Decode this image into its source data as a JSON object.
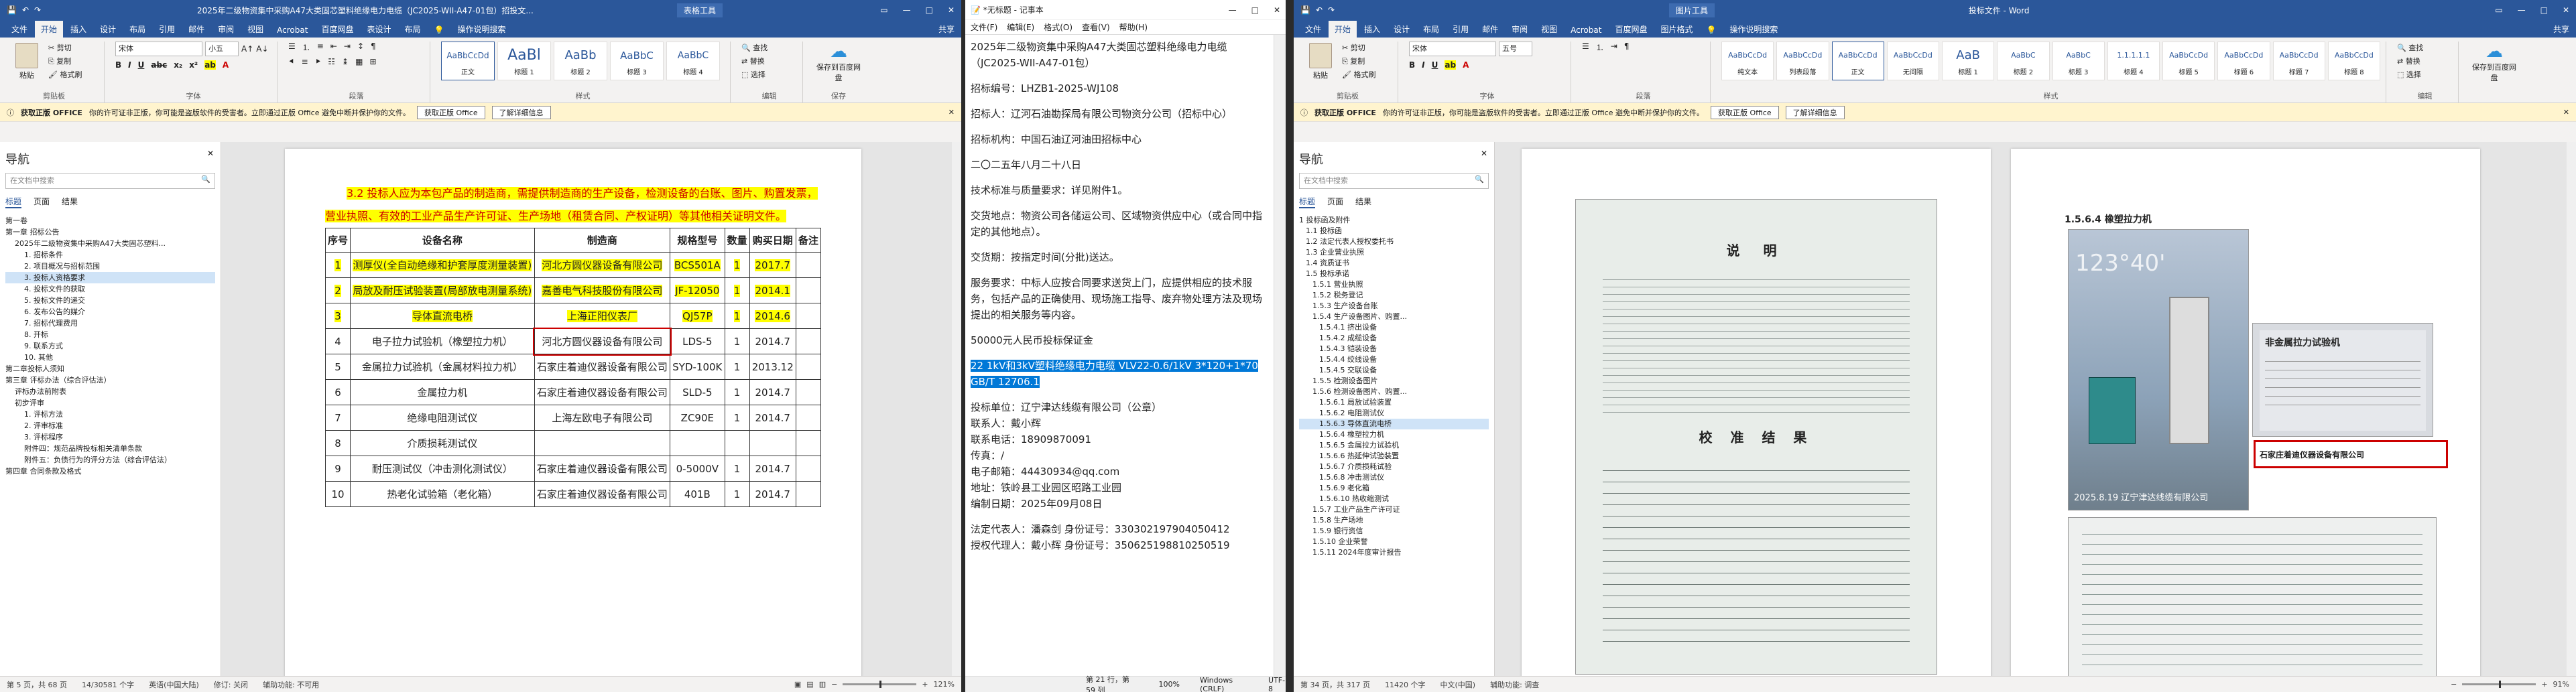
{
  "left_word": {
    "title": "2025年二级物资集中采购A47大类固芯塑料绝缘电力电缆（JC2025-WII-A47-01包）招投文...",
    "title_tools": "表格工具",
    "qat": [
      "文件",
      "↶",
      "↷"
    ],
    "share": "共享",
    "window_controls": [
      "—",
      "□",
      "✕"
    ],
    "tabs": [
      "文件",
      "开始",
      "插入",
      "设计",
      "布局",
      "引用",
      "邮件",
      "审阅",
      "视图",
      "Acrobat",
      "百度网盘",
      "表设计",
      "布局"
    ],
    "active_tab": "开始",
    "search_hint": "操作说明搜索",
    "ribbon": {
      "clipboard": {
        "paste": "粘贴",
        "cut": "剪切",
        "copy": "复制",
        "format_painter": "格式刷",
        "label": "剪贴板"
      },
      "font": {
        "name": "宋体",
        "size": "小五",
        "label": "字体"
      },
      "paragraph_label": "段落",
      "styles": [
        {
          "preview": "AaBbCcDd",
          "name": "正文"
        },
        {
          "preview": "AaBl",
          "name": "标题 1"
        },
        {
          "preview": "AaBb",
          "name": "标题 2"
        },
        {
          "preview": "AaBbC",
          "name": "标题 3"
        },
        {
          "preview": "AaBbC",
          "name": "标题 4"
        }
      ],
      "styles_label": "样式",
      "edit": {
        "find": "查找",
        "replace": "替换",
        "select": "选择",
        "label": "编辑"
      },
      "save": "保存到百度网盘",
      "save_label": "保存"
    },
    "notice": {
      "title": "获取正版 OFFICE",
      "text": "你的许可证非正版，你可能是盗版软件的受害者。立即通过正版 Office 避免中断并保护你的文件。",
      "btn1": "获取正版 Office",
      "btn2": "了解详细信息"
    },
    "nav": {
      "title": "导航",
      "search_placeholder": "在文档中搜索",
      "tabs": [
        "标题",
        "页面",
        "结果"
      ],
      "tree": [
        "第一卷",
        "第一章 招标公告",
        "2025年二级物资集中采购A47大类固芯塑料...",
        "1. 招标条件",
        "2. 项目概况与招标范围",
        "3. 投标人资格要求",
        "4. 投标文件的获取",
        "5. 投标文件的递交",
        "6. 发布公告的媒介",
        "7. 招标代理费用",
        "8. 开标",
        "9. 联系方式",
        "10. 其他",
        "第二章投标人须知",
        "第三章 评标办法（综合评估法）",
        "评标办法前附表",
        "初步评审",
        "1. 评标方法",
        "2. 评审标准",
        "3. 评标程序",
        "附件四：规范品牌投标相关清单条款",
        "附件五：负债行为的评分方法（综合评估法）",
        "第四章 合同条款及格式"
      ],
      "highlighted": "3. 投标人资格要求"
    },
    "doc": {
      "para": "3.2 投标人应为本包产品的制造商，需提供制造商的生产设备，检测设备的台账、图片、购置发票，营业执照、有效的工业产品生产许可证、生产场地（租赁合同、产权证明）等其他相关证明文件。",
      "headers": [
        "序号",
        "设备名称",
        "制造商",
        "规格型号",
        "数量",
        "购买日期",
        "备注"
      ],
      "rows": [
        [
          "1",
          "测厚仪(全自动绝缘和护套厚度测量装置)",
          "河北方圆仪器设备有限公司",
          "BCS501A",
          "1",
          "2017.7",
          ""
        ],
        [
          "2",
          "局放及耐压试验装置(局部放电测量系统)",
          "嘉善电气科技股份有限公司",
          "JF-12050",
          "1",
          "2014.1",
          ""
        ],
        [
          "3",
          "导体直流电桥",
          "上海正阳仪表厂",
          "QJ57P",
          "1",
          "2014.6",
          ""
        ],
        [
          "4",
          "电子拉力试验机（橡塑拉力机）",
          "河北方圆仪器设备有限公司",
          "LDS-5",
          "1",
          "2014.7",
          ""
        ],
        [
          "5",
          "金属拉力试验机（金属材料拉力机）",
          "石家庄着迪仪器设备有限公司",
          "SYD-100K",
          "1",
          "2013.12",
          ""
        ],
        [
          "6",
          "金属拉力机",
          "石家庄着迪仪器设备有限公司",
          "SLD-5",
          "1",
          "2014.7",
          ""
        ],
        [
          "7",
          "绝缘电阻测试仪",
          "上海左欧电子有限公司",
          "ZC90E",
          "1",
          "2014.7",
          ""
        ],
        [
          "8",
          "介质损耗测试仪",
          "",
          "",
          "",
          "",
          ""
        ],
        [
          "9",
          "耐压测试仪（冲击测化测试仪）",
          "石家庄着迪仪器设备有限公司",
          "0-5000V",
          "1",
          "2014.7",
          ""
        ],
        [
          "10",
          "热老化试验箱（老化箱）",
          "石家庄着迪仪器设备有限公司",
          "401B",
          "1",
          "2014.7",
          ""
        ]
      ]
    },
    "status": {
      "page": "第 5 页，共 68 页",
      "words": "14/30581 个字",
      "lang": "英语(中国大陆)",
      "track": "修订: 关闭",
      "access": "辅助功能: 不可用",
      "zoom": "121%"
    }
  },
  "notepad": {
    "title": "*无标题 - 记事本",
    "menu": [
      "文件(F)",
      "编辑(E)",
      "格式(O)",
      "查看(V)",
      "帮助(H)"
    ],
    "window_controls": [
      "—",
      "□",
      "✕"
    ],
    "lines": [
      "2025年二级物资集中采购A47大类固芯塑料绝缘电力电缆（JC2025-WII-A47-01包）",
      "招标编号：LHZB1-2025-WJ108",
      "招标人：辽河石油勘探局有限公司物资分公司（招标中心）",
      "招标机构：中国石油辽河油田招标中心",
      "二〇二五年八月二十八日",
      "技术标准与质量要求：详见附件1。",
      "交货地点：物资公司各储运公司、区域物资供应中心（或合同中指定的其他地点）。",
      "交货期：按指定时间(分批)送达。",
      "服务要求：中标人应按合同要求送货上门，应提供相应的技术服务，包括产品的正确使用、现场施工指导、废弃物处理方法及现场提出的相关服务等内容。",
      "50000元人民币投标保证金"
    ],
    "selected": "22  1kV和3kV塑料绝缘电力电缆 VLV22-0.6/1kV 3*120+1*70 GB/T 12706.1",
    "contact": [
      "投标单位：辽宁津达线缆有限公司（公章）",
      "联系人：戴小辉",
      "联系电话：18909870091",
      "传真：/",
      "电子邮箱：44430934@qq.com",
      "地址：铁岭县工业园区昭路工业园",
      "编制日期：2025年09月08日"
    ],
    "legal": [
      "法定代表人：潘森剑    身份证号：330302197904050412",
      "授权代理人：戴小辉    身份证号：350625198810250519"
    ],
    "status": {
      "pos": "第 21 行，第 59 列",
      "zoom": "100%",
      "eol": "Windows (CRLF)",
      "enc": "UTF-8"
    }
  },
  "right_word": {
    "title": "投标文件 - Word",
    "title_tools": "图片工具",
    "share": "共享",
    "tabs": [
      "文件",
      "开始",
      "插入",
      "设计",
      "布局",
      "引用",
      "邮件",
      "审阅",
      "视图",
      "Acrobat",
      "百度网盘",
      "图片格式"
    ],
    "active_tab": "开始",
    "search_hint": "操作说明搜索",
    "ribbon": {
      "font": {
        "name": "宋体",
        "size": "五号"
      },
      "styles": [
        {
          "preview": "AaBbCcDd",
          "name": "纯文本"
        },
        {
          "preview": "AaBbCcDd",
          "name": "列表段落"
        },
        {
          "preview": "AaBbCcDd",
          "name": "正文"
        },
        {
          "preview": "AaBbCcDd",
          "name": "无间隔"
        },
        {
          "preview": "AaB",
          "name": "标题 1"
        },
        {
          "preview": "AaBbC",
          "name": "标题 2"
        },
        {
          "preview": "AaBbC",
          "name": "标题 3"
        },
        {
          "preview": "1.1.1.1.1",
          "name": "标题 4"
        },
        {
          "preview": "AaBbCcDd",
          "name": "标题 5"
        },
        {
          "preview": "AaBbCcDd",
          "name": "标题 6"
        },
        {
          "preview": "AaBbCcDd",
          "name": "标题 7"
        },
        {
          "preview": "AaBbCcDd",
          "name": "标题 8"
        }
      ]
    },
    "notice": {
      "title": "获取正版 OFFICE",
      "text": "你的许可证非正版，你可能是盗版软件的受害者。立即通过正版 Office 避免中断并保护你的文件。",
      "btn1": "获取正版 Office",
      "btn2": "了解详细信息"
    },
    "nav": {
      "title": "导航",
      "search_placeholder": "在文档中搜索",
      "tabs": [
        "标题",
        "页面",
        "结果"
      ],
      "tree": [
        "1 投标函及附件",
        "1.1 投标函",
        "1.2 法定代表人授权委托书",
        "1.3 企业营业执照",
        "1.4 资质证书",
        "1.5 投标承诺",
        "1.5.1 营业执照",
        "1.5.2 税务登记",
        "1.5.3 生产设备台账",
        "1.5.4 生产设备图片、购置...",
        "1.5.4.1 挤出设备",
        "1.5.4.2 成缆设备",
        "1.5.4.3 铠装设备",
        "1.5.4.4 绞线设备",
        "1.5.4.5 交联设备",
        "1.5.5 检测设备图片",
        "1.5.6 检测设备图片、购置...",
        "1.5.6.1 局放试验装置",
        "1.5.6.2 电阻测试仪",
        "1.5.6.3 导体直流电桥",
        "1.5.6.4 橡塑拉力机",
        "1.5.6.5 金属拉力试验机",
        "1.5.6.6 热延伸试验装置",
        "1.5.6.7 介质损耗试验",
        "1.5.6.8 冲击测试仪",
        "1.5.6.9 老化箱",
        "1.5.6.10 热收缩测试",
        "1.5.7 工业产品生产许可证",
        "1.5.8 生产场地",
        "1.5.9 银行资信",
        "1.5.10 企业荣誉",
        "1.5.11 2024年度审计报告"
      ],
      "highlighted": "1.5.6.3 导体直流电桥"
    },
    "page_left": {
      "caption": "说 明",
      "sub": "校 准 结 果"
    },
    "page_right": {
      "heading": "1.5.6.4  橡塑拉力机",
      "label_title": "非金属拉力试验机",
      "label_maker": "石家庄着迪仪器设备有限公司",
      "photo_text": "2025.8.19 辽宁津达线缆有限公司",
      "time": "123°40'"
    },
    "status": {
      "page": "第 34 页，共 317 页",
      "words": "11420 个字",
      "lang": "中文(中国)",
      "access": "辅助功能: 调查",
      "zoom": "91%"
    }
  }
}
